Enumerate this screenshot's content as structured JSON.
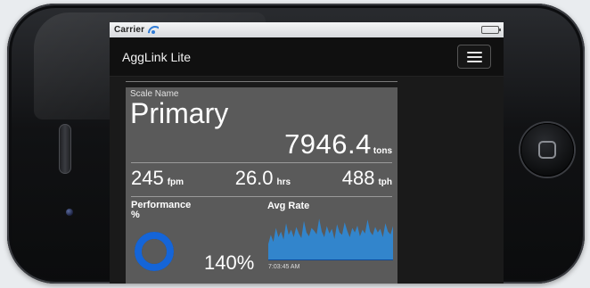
{
  "device": {
    "icons": [
      "volume-button",
      "front-camera",
      "home-button"
    ]
  },
  "status_bar": {
    "carrier": "Carrier",
    "icons": [
      "wifi-icon",
      "battery-icon"
    ],
    "battery_level": 1.0
  },
  "header": {
    "title": "AggLink Lite",
    "menu_icon": "hamburger-menu-icon"
  },
  "card": {
    "scale_label": "Scale Name",
    "scale_name": "Primary",
    "total": {
      "value": "7946.4",
      "unit": "tons"
    },
    "metrics": [
      {
        "value": "245",
        "unit": "fpm"
      },
      {
        "value": "26.0",
        "unit": "hrs"
      },
      {
        "value": "488",
        "unit": "tph"
      }
    ],
    "performance": {
      "label": "Performance %",
      "value": "140%",
      "gauge_fraction": 1.0
    },
    "avg_rate": {
      "label": "Avg Rate",
      "time": "7:03:45 AM",
      "series": [
        0.35,
        0.55,
        0.4,
        0.7,
        0.5,
        0.62,
        0.45,
        0.8,
        0.55,
        0.66,
        0.5,
        0.72,
        0.58,
        0.48,
        0.85,
        0.6,
        0.52,
        0.7,
        0.64,
        0.56,
        0.9,
        0.62,
        0.5,
        0.74,
        0.58,
        0.68,
        0.46,
        0.78,
        0.6,
        0.55,
        0.82,
        0.64,
        0.5,
        0.7,
        0.6,
        0.75,
        0.52,
        0.66,
        0.58,
        0.88,
        0.62,
        0.54,
        0.72,
        0.6,
        0.68,
        0.5,
        0.8,
        0.62,
        0.56,
        0.74
      ],
      "color": "#2b8de0"
    },
    "accent_color": "#1565d8"
  }
}
